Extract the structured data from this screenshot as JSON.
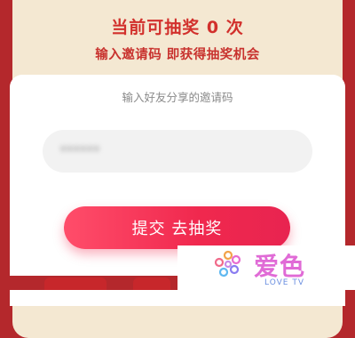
{
  "header": {
    "draw_count_text": "当前可抽奖 0 次",
    "subtitle": "输入邀请码 即获得抽奖机会"
  },
  "dialog": {
    "title": "输入好友分享的邀请码",
    "input_value": "******"
  },
  "submit_button": {
    "label": "提交 去抽奖"
  },
  "watermark": {
    "brand": "爱色",
    "sub": "LOVE TV",
    "icon": "flower-logo-icon"
  },
  "colors": {
    "background_red": "#b4282c",
    "header_red": "#d2302c",
    "button_pink": "#f0284e",
    "card_cream": "#f4e8d2"
  }
}
